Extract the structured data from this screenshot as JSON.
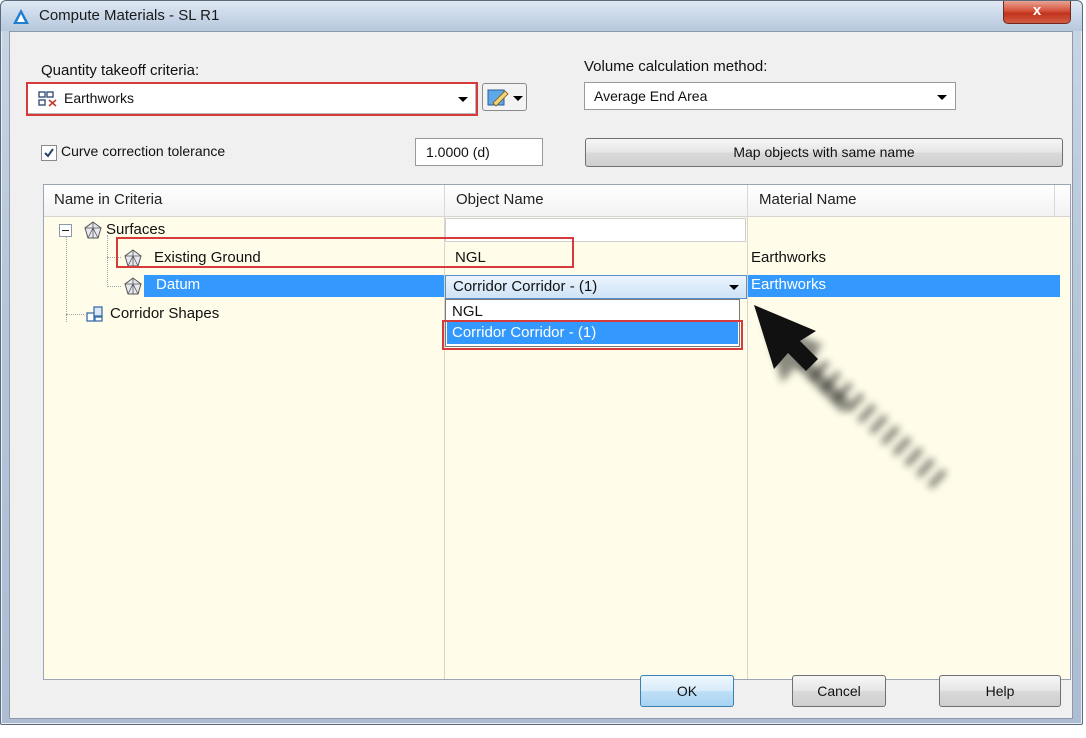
{
  "window": {
    "title": "Compute Materials - SL R1",
    "close_glyph": "x"
  },
  "criteria": {
    "label": "Quantity takeoff criteria:",
    "value": "Earthworks",
    "icon": "criteria-icon"
  },
  "volume": {
    "label": "Volume calculation method:",
    "value": "Average End Area"
  },
  "curve": {
    "checked": true,
    "label": "Curve correction tolerance",
    "value": "1.0000 (d)"
  },
  "map_button_label": "Map objects with same name",
  "grid": {
    "headers": [
      "Name in Criteria",
      "Object Name",
      "Material Name"
    ],
    "tree": {
      "surfaces": "Surfaces",
      "existing_ground": "Existing Ground",
      "datum": "Datum",
      "corridor_shapes": "Corridor Shapes"
    },
    "rows": {
      "existing_ground": {
        "object": "NGL",
        "material": "Earthworks"
      },
      "datum": {
        "object": "Corridor Corridor - (1)",
        "material": "Earthworks"
      }
    },
    "dropdown_options": [
      "NGL",
      "Corridor Corridor - (1)"
    ],
    "selected_option": "Corridor Corridor - (1)"
  },
  "buttons": {
    "ok": "OK",
    "cancel": "Cancel",
    "help": "Help"
  },
  "colors": {
    "highlight": "#3399ff",
    "annotation_red": "#d63a3a",
    "grid_bg": "#fffde9"
  }
}
